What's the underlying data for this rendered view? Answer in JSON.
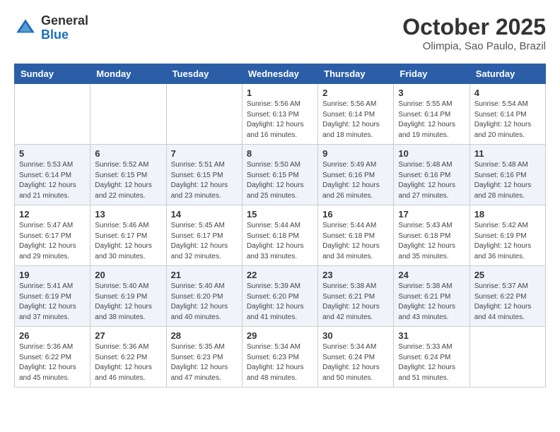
{
  "header": {
    "logo_general": "General",
    "logo_blue": "Blue",
    "month_title": "October 2025",
    "location": "Olimpia, Sao Paulo, Brazil"
  },
  "weekdays": [
    "Sunday",
    "Monday",
    "Tuesday",
    "Wednesday",
    "Thursday",
    "Friday",
    "Saturday"
  ],
  "weeks": [
    [
      {
        "day": "",
        "info": ""
      },
      {
        "day": "",
        "info": ""
      },
      {
        "day": "",
        "info": ""
      },
      {
        "day": "1",
        "info": "Sunrise: 5:56 AM\nSunset: 6:13 PM\nDaylight: 12 hours and 16 minutes."
      },
      {
        "day": "2",
        "info": "Sunrise: 5:56 AM\nSunset: 6:14 PM\nDaylight: 12 hours and 18 minutes."
      },
      {
        "day": "3",
        "info": "Sunrise: 5:55 AM\nSunset: 6:14 PM\nDaylight: 12 hours and 19 minutes."
      },
      {
        "day": "4",
        "info": "Sunrise: 5:54 AM\nSunset: 6:14 PM\nDaylight: 12 hours and 20 minutes."
      }
    ],
    [
      {
        "day": "5",
        "info": "Sunrise: 5:53 AM\nSunset: 6:14 PM\nDaylight: 12 hours and 21 minutes."
      },
      {
        "day": "6",
        "info": "Sunrise: 5:52 AM\nSunset: 6:15 PM\nDaylight: 12 hours and 22 minutes."
      },
      {
        "day": "7",
        "info": "Sunrise: 5:51 AM\nSunset: 6:15 PM\nDaylight: 12 hours and 23 minutes."
      },
      {
        "day": "8",
        "info": "Sunrise: 5:50 AM\nSunset: 6:15 PM\nDaylight: 12 hours and 25 minutes."
      },
      {
        "day": "9",
        "info": "Sunrise: 5:49 AM\nSunset: 6:16 PM\nDaylight: 12 hours and 26 minutes."
      },
      {
        "day": "10",
        "info": "Sunrise: 5:48 AM\nSunset: 6:16 PM\nDaylight: 12 hours and 27 minutes."
      },
      {
        "day": "11",
        "info": "Sunrise: 5:48 AM\nSunset: 6:16 PM\nDaylight: 12 hours and 28 minutes."
      }
    ],
    [
      {
        "day": "12",
        "info": "Sunrise: 5:47 AM\nSunset: 6:17 PM\nDaylight: 12 hours and 29 minutes."
      },
      {
        "day": "13",
        "info": "Sunrise: 5:46 AM\nSunset: 6:17 PM\nDaylight: 12 hours and 30 minutes."
      },
      {
        "day": "14",
        "info": "Sunrise: 5:45 AM\nSunset: 6:17 PM\nDaylight: 12 hours and 32 minutes."
      },
      {
        "day": "15",
        "info": "Sunrise: 5:44 AM\nSunset: 6:18 PM\nDaylight: 12 hours and 33 minutes."
      },
      {
        "day": "16",
        "info": "Sunrise: 5:44 AM\nSunset: 6:18 PM\nDaylight: 12 hours and 34 minutes."
      },
      {
        "day": "17",
        "info": "Sunrise: 5:43 AM\nSunset: 6:18 PM\nDaylight: 12 hours and 35 minutes."
      },
      {
        "day": "18",
        "info": "Sunrise: 5:42 AM\nSunset: 6:19 PM\nDaylight: 12 hours and 36 minutes."
      }
    ],
    [
      {
        "day": "19",
        "info": "Sunrise: 5:41 AM\nSunset: 6:19 PM\nDaylight: 12 hours and 37 minutes."
      },
      {
        "day": "20",
        "info": "Sunrise: 5:40 AM\nSunset: 6:19 PM\nDaylight: 12 hours and 38 minutes."
      },
      {
        "day": "21",
        "info": "Sunrise: 5:40 AM\nSunset: 6:20 PM\nDaylight: 12 hours and 40 minutes."
      },
      {
        "day": "22",
        "info": "Sunrise: 5:39 AM\nSunset: 6:20 PM\nDaylight: 12 hours and 41 minutes."
      },
      {
        "day": "23",
        "info": "Sunrise: 5:38 AM\nSunset: 6:21 PM\nDaylight: 12 hours and 42 minutes."
      },
      {
        "day": "24",
        "info": "Sunrise: 5:38 AM\nSunset: 6:21 PM\nDaylight: 12 hours and 43 minutes."
      },
      {
        "day": "25",
        "info": "Sunrise: 5:37 AM\nSunset: 6:22 PM\nDaylight: 12 hours and 44 minutes."
      }
    ],
    [
      {
        "day": "26",
        "info": "Sunrise: 5:36 AM\nSunset: 6:22 PM\nDaylight: 12 hours and 45 minutes."
      },
      {
        "day": "27",
        "info": "Sunrise: 5:36 AM\nSunset: 6:22 PM\nDaylight: 12 hours and 46 minutes."
      },
      {
        "day": "28",
        "info": "Sunrise: 5:35 AM\nSunset: 6:23 PM\nDaylight: 12 hours and 47 minutes."
      },
      {
        "day": "29",
        "info": "Sunrise: 5:34 AM\nSunset: 6:23 PM\nDaylight: 12 hours and 48 minutes."
      },
      {
        "day": "30",
        "info": "Sunrise: 5:34 AM\nSunset: 6:24 PM\nDaylight: 12 hours and 50 minutes."
      },
      {
        "day": "31",
        "info": "Sunrise: 5:33 AM\nSunset: 6:24 PM\nDaylight: 12 hours and 51 minutes."
      },
      {
        "day": "",
        "info": ""
      }
    ]
  ]
}
